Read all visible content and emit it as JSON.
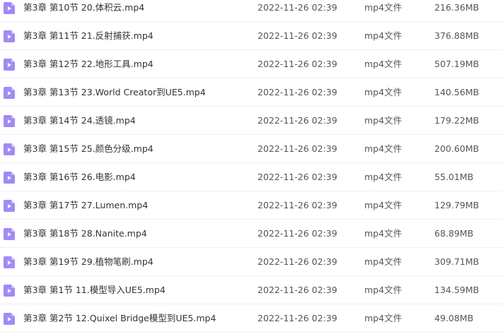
{
  "colors": {
    "video_icon": "#a18af5",
    "video_icon_fold": "#c9bcfb",
    "row_divider": "#eef0f4"
  },
  "icon": "video-file-icon",
  "files": [
    {
      "name": "第3章 第10节 20.体积云.mp4",
      "date": "2022-11-26 02:39",
      "type": "mp4文件",
      "size": "216.36MB"
    },
    {
      "name": "第3章 第11节 21.反射捕获.mp4",
      "date": "2022-11-26 02:39",
      "type": "mp4文件",
      "size": "376.88MB"
    },
    {
      "name": "第3章 第12节 22.地形工具.mp4",
      "date": "2022-11-26 02:39",
      "type": "mp4文件",
      "size": "507.19MB"
    },
    {
      "name": "第3章 第13节 23.World Creator到UE5.mp4",
      "date": "2022-11-26 02:39",
      "type": "mp4文件",
      "size": "140.56MB"
    },
    {
      "name": "第3章 第14节 24.透镜.mp4",
      "date": "2022-11-26 02:39",
      "type": "mp4文件",
      "size": "179.22MB"
    },
    {
      "name": "第3章 第15节 25.颜色分级.mp4",
      "date": "2022-11-26 02:39",
      "type": "mp4文件",
      "size": "200.60MB"
    },
    {
      "name": "第3章 第16节 26.电影.mp4",
      "date": "2022-11-26 02:39",
      "type": "mp4文件",
      "size": "55.01MB"
    },
    {
      "name": "第3章 第17节 27.Lumen.mp4",
      "date": "2022-11-26 02:39",
      "type": "mp4文件",
      "size": "129.79MB"
    },
    {
      "name": "第3章 第18节 28.Nanite.mp4",
      "date": "2022-11-26 02:39",
      "type": "mp4文件",
      "size": "68.89MB"
    },
    {
      "name": "第3章 第19节 29.植物笔刷.mp4",
      "date": "2022-11-26 02:39",
      "type": "mp4文件",
      "size": "309.71MB"
    },
    {
      "name": "第3章 第1节 11.模型导入UE5.mp4",
      "date": "2022-11-26 02:39",
      "type": "mp4文件",
      "size": "134.59MB"
    },
    {
      "name": "第3章 第2节 12.Quixel Bridge模型到UE5.mp4",
      "date": "2022-11-26 02:39",
      "type": "mp4文件",
      "size": "49.08MB"
    }
  ]
}
